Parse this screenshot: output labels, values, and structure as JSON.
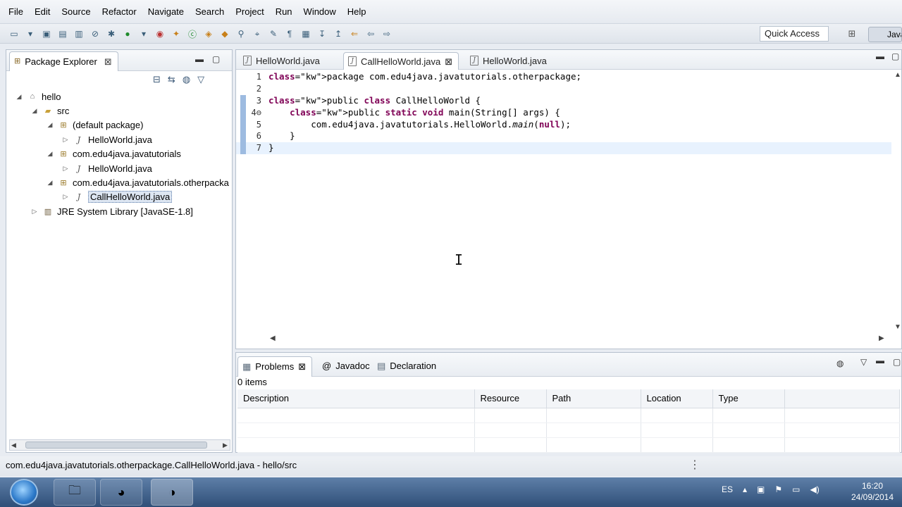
{
  "menu": [
    "File",
    "Edit",
    "Source",
    "Refactor",
    "Navigate",
    "Search",
    "Project",
    "Run",
    "Window",
    "Help"
  ],
  "toolbar": {
    "quick_access": "Quick Access",
    "perspective_label": "Java"
  },
  "package_explorer": {
    "title": "Package Explorer",
    "close_glyph": "⊠",
    "tree": [
      {
        "label": "hello",
        "level": 0,
        "icon": "project-icon",
        "expanded": true
      },
      {
        "label": "src",
        "level": 1,
        "icon": "source-folder-icon",
        "expanded": true
      },
      {
        "label": "(default package)",
        "level": 2,
        "icon": "package-icon",
        "expanded": true
      },
      {
        "label": "HelloWorld.java",
        "level": 3,
        "icon": "java-file-icon",
        "expanded": false
      },
      {
        "label": "com.edu4java.javatutorials",
        "level": 2,
        "icon": "package-icon",
        "expanded": true
      },
      {
        "label": "HelloWorld.java",
        "level": 3,
        "icon": "java-file-icon",
        "expanded": false
      },
      {
        "label": "com.edu4java.javatutorials.otherpacka",
        "level": 2,
        "icon": "package-icon",
        "expanded": true
      },
      {
        "label": "CallHelloWorld.java",
        "level": 3,
        "icon": "java-file-icon",
        "expanded": false,
        "selected": true
      },
      {
        "label": "JRE System Library [JavaSE-1.8]",
        "level": 1,
        "icon": "library-icon",
        "expanded": false
      }
    ]
  },
  "editor": {
    "tabs": [
      {
        "label": "HelloWorld.java",
        "active": false
      },
      {
        "label": "CallHelloWorld.java",
        "active": true
      },
      {
        "label": "HelloWorld.java",
        "active": false
      }
    ],
    "lines": [
      {
        "num": "1",
        "text": "package com.edu4java.javatutorials.otherpackage;"
      },
      {
        "num": "2",
        "text": ""
      },
      {
        "num": "3",
        "text": "public class CallHelloWorld {"
      },
      {
        "num": "4⊖",
        "text": "    public static void main(String[] args) {"
      },
      {
        "num": "5",
        "text": "        com.edu4java.javatutorials.HelloWorld.main(null);"
      },
      {
        "num": "6",
        "text": "    }"
      },
      {
        "num": "7",
        "text": "}"
      }
    ]
  },
  "problems": {
    "tabs": [
      "Problems",
      "Javadoc",
      "Declaration"
    ],
    "count": "0 items",
    "columns": [
      "Description",
      "Resource",
      "Path",
      "Location",
      "Type"
    ]
  },
  "status": {
    "text": "com.edu4java.javatutorials.otherpackage.CallHelloWorld.java - hello/src"
  },
  "taskbar": {
    "language": "ES",
    "time": "16:20",
    "date": "24/09/2014"
  }
}
